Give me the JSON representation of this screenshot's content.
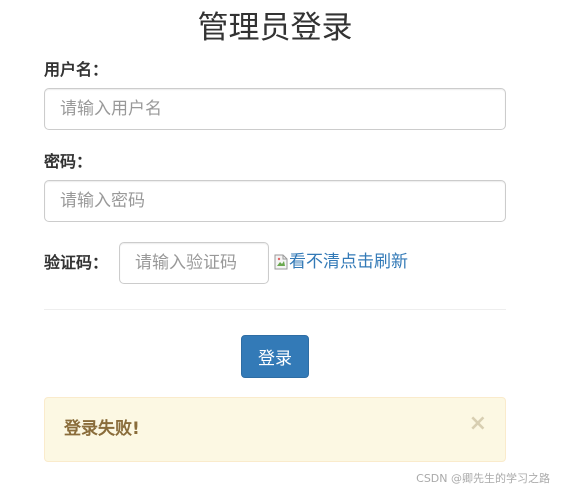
{
  "page": {
    "title": "管理员登录"
  },
  "form": {
    "username_label": "用户名：",
    "username_placeholder": "请输入用户名",
    "username_value": "",
    "password_label": "密码：",
    "password_placeholder": "请输入密码",
    "password_value": "",
    "captcha_label": "验证码：",
    "captcha_placeholder": "请输入验证码",
    "captcha_value": "",
    "captcha_link_text": "看不清点击刷新",
    "captcha_image_icon": "broken-image-icon",
    "submit_label": "登录"
  },
  "alert": {
    "message": "登录失败!",
    "close_symbol": "×",
    "type": "warning"
  },
  "watermark": {
    "text": "CSDN @卿先生的学习之路"
  },
  "colors": {
    "primary": "#337ab7",
    "alert_bg": "#fcf8e3",
    "alert_text": "#8a6d3b"
  }
}
